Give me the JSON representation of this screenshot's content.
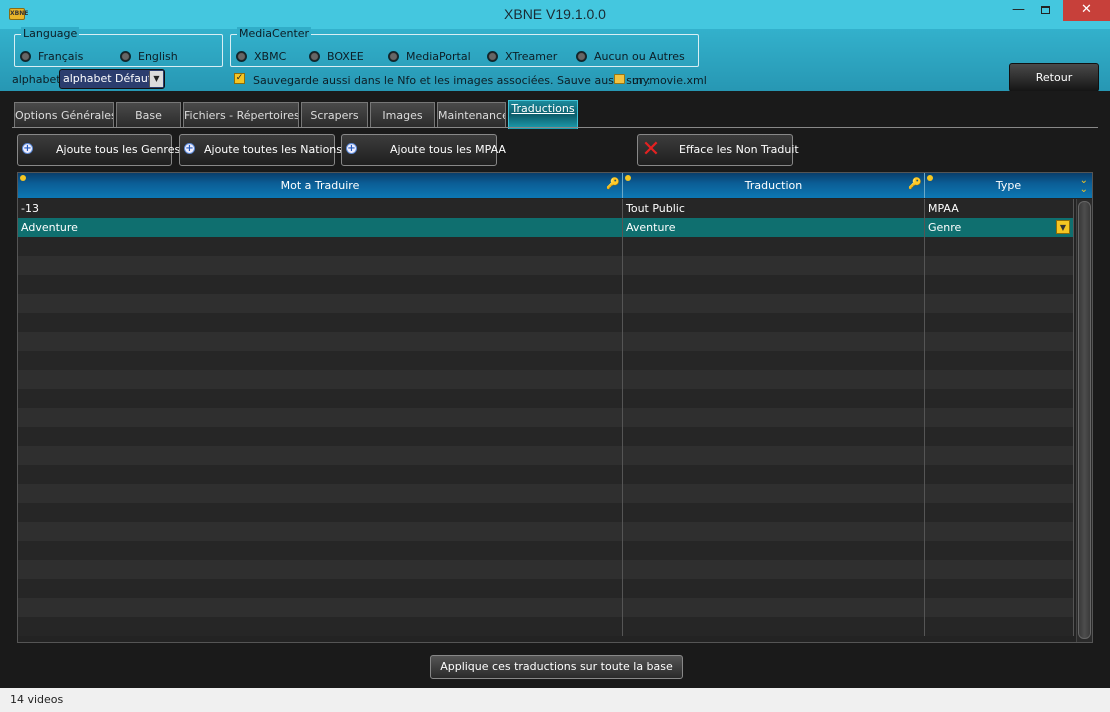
{
  "window": {
    "title": "XBNE V19.1.0.0",
    "icon_label": "XBNE",
    "min_label": "—",
    "close_label": "✕"
  },
  "language": {
    "group_title": "Language",
    "options": [
      "Français",
      "English"
    ]
  },
  "mediacenter": {
    "group_title": "MediaCenter",
    "options": [
      "XBMC",
      "BOXEE",
      "MediaPortal",
      "XTreamer",
      "Aucun ou Autres"
    ]
  },
  "alphabet": {
    "label": "alphabet",
    "selected": "alphabet Défaut",
    "arrow": "▼"
  },
  "save_option": {
    "checked_mark": "✓",
    "label": "Sauvegarde aussi dans le Nfo et les images associées.  Sauve aussi sur :",
    "file": "mymovie.xml"
  },
  "retour_label": "Retour",
  "tabs": [
    "Options Générales",
    "Base",
    "Fichiers - Répertoires",
    "Scrapers",
    "Images",
    "Maintenance",
    "Traductions"
  ],
  "actions": {
    "add_genres": "Ajoute tous les Genres",
    "add_nations": "Ajoute toutes les Nations",
    "add_mpaa": "Ajoute tous les MPAA",
    "clear_untranslated": "Efface les Non Traduit",
    "plus_glyph": "+",
    "x_glyph": "✕"
  },
  "grid": {
    "columns": [
      "Mot a Traduire",
      "Traduction",
      "Type"
    ],
    "rows": [
      [
        "-13",
        "Tout Public",
        "MPAA"
      ],
      [
        "Adventure",
        "Aventure",
        "Genre"
      ]
    ],
    "key_glyph": "🔑",
    "chevron_glyph": "⌄",
    "dropdown_glyph": "▼"
  },
  "apply_label": "Applique ces traductions sur toute la base",
  "status": "14 videos",
  "colors": {
    "titlebar": "#44c7df",
    "panel": "#2fa9c4",
    "selected_row": "#0f6f6f",
    "header": "#0d6aa5",
    "accent_yellow": "#f5c622",
    "close_red": "#c7403a"
  }
}
